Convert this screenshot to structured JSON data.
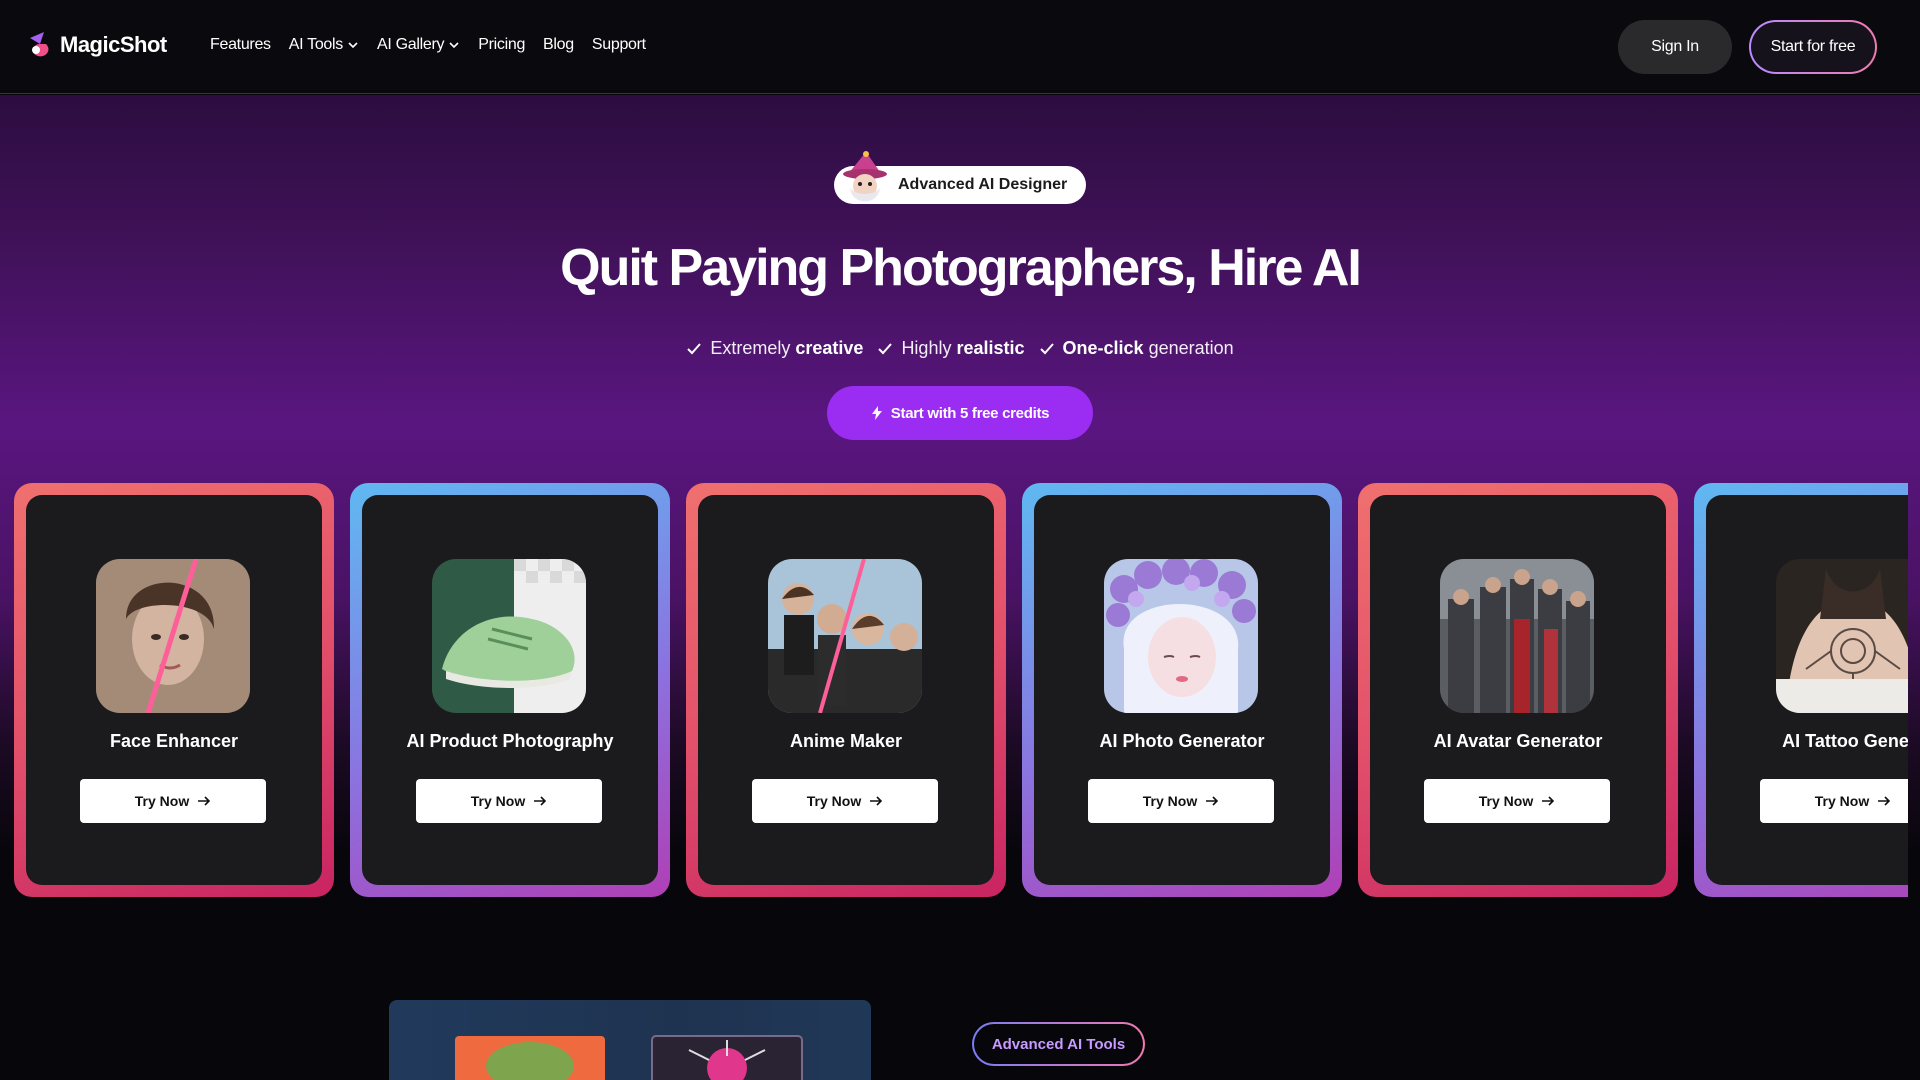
{
  "brand": {
    "name": "MagicShot"
  },
  "nav": {
    "links": [
      {
        "label": "Features"
      },
      {
        "label": "AI Tools"
      },
      {
        "label": "AI Gallery"
      },
      {
        "label": "Pricing"
      },
      {
        "label": "Blog"
      },
      {
        "label": "Support"
      }
    ],
    "sign_in": "Sign In",
    "start_free": "Start for free"
  },
  "hero": {
    "badge": "Advanced AI Designer",
    "headline": "Quit Paying Photographers, Hire AI",
    "features": [
      {
        "prefix": "Extremely ",
        "bold": "creative",
        "suffix": ""
      },
      {
        "prefix": "Highly ",
        "bold": "realistic",
        "suffix": ""
      },
      {
        "prefix": "",
        "bold": "One-click",
        "suffix": " generation"
      }
    ],
    "cta": "Start with 5 free credits"
  },
  "cards": [
    {
      "title": "Face Enhancer",
      "button": "Try Now",
      "style": "pink"
    },
    {
      "title": "AI Product Photography",
      "button": "Try Now",
      "style": "blue"
    },
    {
      "title": "Anime Maker",
      "button": "Try Now",
      "style": "pink"
    },
    {
      "title": "AI Photo Generator",
      "button": "Try Now",
      "style": "blue"
    },
    {
      "title": "AI Avatar Generator",
      "button": "Try Now",
      "style": "pink"
    },
    {
      "title": "AI Tattoo Genera",
      "button": "Try Now",
      "style": "blue"
    }
  ],
  "bottom": {
    "advanced_tools": "Advanced AI Tools"
  },
  "colors": {
    "accent": "#9b2cf2",
    "card_pink": "#e2506a",
    "card_blue": "#5fb9f2"
  }
}
